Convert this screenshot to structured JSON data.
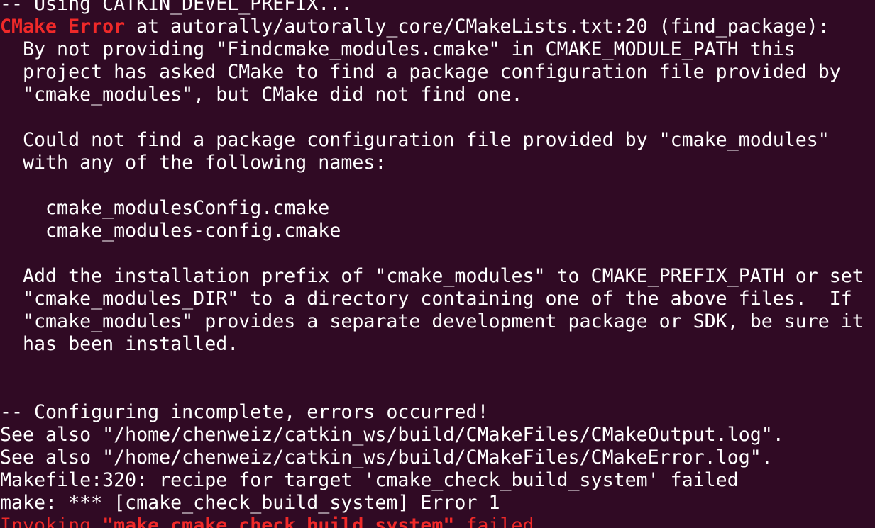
{
  "terminal": {
    "colors": {
      "background": "#300a24",
      "foreground": "#ffffff",
      "error": "#ef2929"
    },
    "lines": [
      {
        "parts": [
          {
            "text": "-- Using CATKIN_DEVEL_PREFIX...",
            "style": "cut"
          }
        ]
      },
      {
        "parts": [
          {
            "text": "CMake Error",
            "style": "err-bold"
          },
          {
            "text": " at autorally/autorally_core/CMakeLists.txt:20 (find_package):",
            "style": "normal"
          }
        ]
      },
      {
        "parts": [
          {
            "text": "  By not providing \"Findcmake_modules.cmake\" in CMAKE_MODULE_PATH this",
            "style": "normal"
          }
        ]
      },
      {
        "parts": [
          {
            "text": "  project has asked CMake to find a package configuration file provided by",
            "style": "normal"
          }
        ]
      },
      {
        "parts": [
          {
            "text": "  \"cmake_modules\", but CMake did not find one.",
            "style": "normal"
          }
        ]
      },
      {
        "parts": [
          {
            "text": "",
            "style": "normal"
          }
        ]
      },
      {
        "parts": [
          {
            "text": "  Could not find a package configuration file provided by \"cmake_modules\"",
            "style": "normal"
          }
        ]
      },
      {
        "parts": [
          {
            "text": "  with any of the following names:",
            "style": "normal"
          }
        ]
      },
      {
        "parts": [
          {
            "text": "",
            "style": "normal"
          }
        ]
      },
      {
        "parts": [
          {
            "text": "    cmake_modulesConfig.cmake",
            "style": "normal"
          }
        ]
      },
      {
        "parts": [
          {
            "text": "    cmake_modules-config.cmake",
            "style": "normal"
          }
        ]
      },
      {
        "parts": [
          {
            "text": "",
            "style": "normal"
          }
        ]
      },
      {
        "parts": [
          {
            "text": "  Add the installation prefix of \"cmake_modules\" to CMAKE_PREFIX_PATH or set",
            "style": "normal"
          }
        ]
      },
      {
        "parts": [
          {
            "text": "  \"cmake_modules_DIR\" to a directory containing one of the above files.  If",
            "style": "normal"
          }
        ]
      },
      {
        "parts": [
          {
            "text": "  \"cmake_modules\" provides a separate development package or SDK, be sure it",
            "style": "normal"
          }
        ]
      },
      {
        "parts": [
          {
            "text": "  has been installed.",
            "style": "normal"
          }
        ]
      },
      {
        "parts": [
          {
            "text": "",
            "style": "normal"
          }
        ]
      },
      {
        "parts": [
          {
            "text": "",
            "style": "normal"
          }
        ]
      },
      {
        "parts": [
          {
            "text": "-- Configuring incomplete, errors occurred!",
            "style": "normal"
          }
        ]
      },
      {
        "parts": [
          {
            "text": "See also \"/home/chenweiz/catkin_ws/build/CMakeFiles/CMakeOutput.log\".",
            "style": "normal"
          }
        ]
      },
      {
        "parts": [
          {
            "text": "See also \"/home/chenweiz/catkin_ws/build/CMakeFiles/CMakeError.log\".",
            "style": "normal"
          }
        ]
      },
      {
        "parts": [
          {
            "text": "Makefile:320: recipe for target 'cmake_check_build_system' failed",
            "style": "normal"
          }
        ]
      },
      {
        "parts": [
          {
            "text": "make: *** [cmake_check_build_system] Error 1",
            "style": "normal"
          }
        ]
      },
      {
        "parts": [
          {
            "text": "Invoking ",
            "style": "err-red"
          },
          {
            "text": "\"make cmake_check_build_system\"",
            "style": "err-bold"
          },
          {
            "text": " failed",
            "style": "err-red"
          }
        ]
      }
    ]
  }
}
